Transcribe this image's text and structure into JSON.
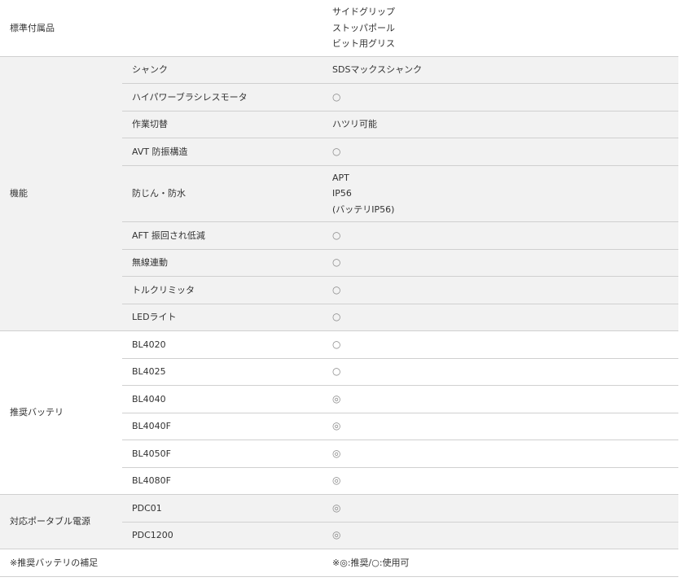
{
  "groups": [
    {
      "label": "標準付属品",
      "shaded": false,
      "single": true,
      "rows": [
        {
          "name": "",
          "value": [
            "サイドグリップ",
            "ストッパポール",
            "ビット用グリス"
          ]
        }
      ]
    },
    {
      "label": "機能",
      "shaded": true,
      "rows": [
        {
          "name": "シャンク",
          "value": [
            "SDSマックスシャンク"
          ]
        },
        {
          "name": "ハイパワーブラシレスモータ",
          "value": [
            "○"
          ]
        },
        {
          "name": "作業切替",
          "value": [
            "ハツリ可能"
          ]
        },
        {
          "name": "AVT 防振構造",
          "value": [
            "○"
          ]
        },
        {
          "name": "防じん・防水",
          "value": [
            "APT",
            "IP56",
            "(バッテリIP56)"
          ]
        },
        {
          "name": "AFT 振回され低減",
          "value": [
            "○"
          ]
        },
        {
          "name": "無線連動",
          "value": [
            "○"
          ]
        },
        {
          "name": "トルクリミッタ",
          "value": [
            "○"
          ]
        },
        {
          "name": "LEDライト",
          "value": [
            "○"
          ]
        }
      ]
    },
    {
      "label": "推奨バッテリ",
      "shaded": false,
      "rows": [
        {
          "name": "BL4020",
          "value": [
            "○"
          ]
        },
        {
          "name": "BL4025",
          "value": [
            "○"
          ]
        },
        {
          "name": "BL4040",
          "value": [
            "◎"
          ]
        },
        {
          "name": "BL4040F",
          "value": [
            "◎"
          ]
        },
        {
          "name": "BL4050F",
          "value": [
            "◎"
          ]
        },
        {
          "name": "BL4080F",
          "value": [
            "◎"
          ]
        }
      ]
    },
    {
      "label": "対応ポータブル電源",
      "shaded": true,
      "rows": [
        {
          "name": "PDC01",
          "value": [
            "◎"
          ]
        },
        {
          "name": "PDC1200",
          "value": [
            "◎"
          ]
        }
      ]
    },
    {
      "label": "※推奨バッテリの補足",
      "shaded": false,
      "single": true,
      "rows": [
        {
          "name": "",
          "value": [
            "※◎:推奨/○:使用可"
          ]
        }
      ]
    }
  ]
}
